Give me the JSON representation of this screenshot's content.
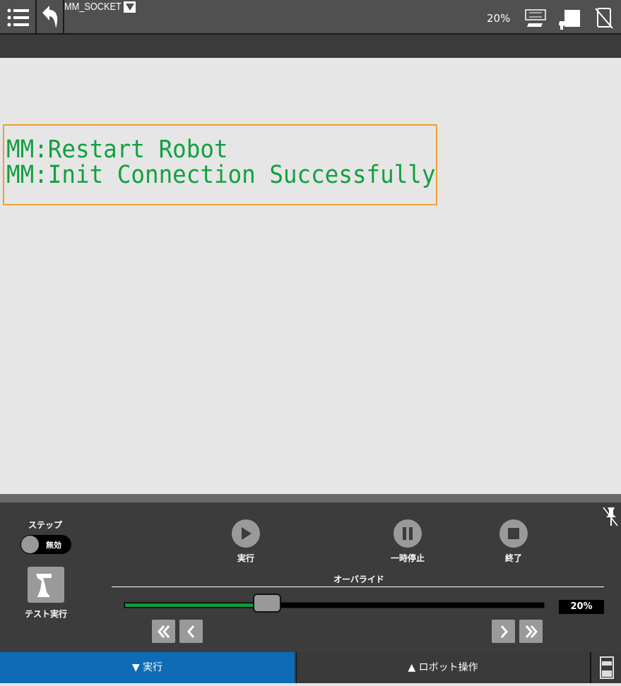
{
  "header": {
    "program_name": "MM_SOCKET",
    "override": "20%",
    "icons": [
      "menu-icon",
      "back-icon",
      "auto-mode-icon",
      "teach-pendant-icon",
      "no-device-icon"
    ]
  },
  "messages": [
    "MM:Restart Robot",
    "MM:Init Connection Successfully"
  ],
  "panel": {
    "step_label": "ステップ",
    "step_toggle": "無効",
    "test_run_label": "テスト実行",
    "run_label": "実行",
    "pause_label": "一時停止",
    "stop_label": "終了",
    "override_label": "オーバライド",
    "override_value": "20%",
    "override_percent": 20
  },
  "tabs": {
    "run": "▼ 実行",
    "robot": "▲ ロボット操作"
  },
  "colors": {
    "message": "#12a040",
    "box_border": "#f0a030",
    "slider_fill": "#0e9a3e",
    "tab_active": "#0d6cb5"
  }
}
